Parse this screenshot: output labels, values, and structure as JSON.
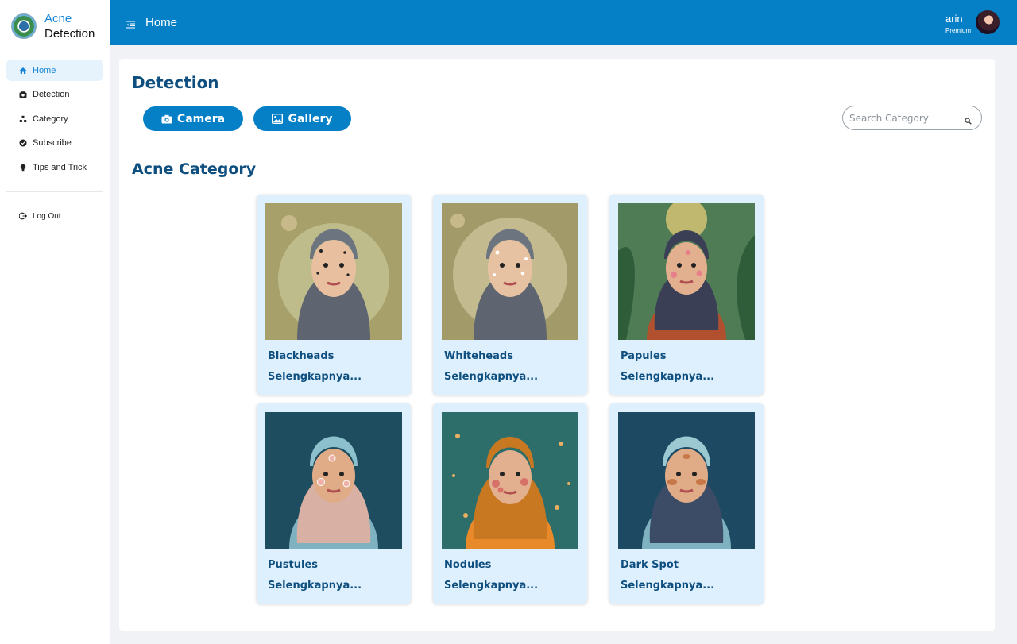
{
  "brand": {
    "line1": "Acne",
    "line2": "Detection"
  },
  "sidebar": {
    "items": [
      {
        "label": "Home",
        "icon": "home-icon",
        "active": true
      },
      {
        "label": "Detection",
        "icon": "camera-icon"
      },
      {
        "label": "Category",
        "icon": "category-icon"
      },
      {
        "label": "Subscribe",
        "icon": "subscribe-icon"
      },
      {
        "label": "Tips and Trick",
        "icon": "bulb-icon"
      }
    ],
    "logout": "Log Out"
  },
  "topbar": {
    "title": "Home",
    "user": {
      "name": "arin",
      "role": "Premium"
    }
  },
  "detection": {
    "heading": "Detection",
    "camera_label": "Camera",
    "gallery_label": "Gallery",
    "search_placeholder": "Search Category"
  },
  "category": {
    "heading": "Acne Category",
    "link_label": "Selengkapnya...",
    "cards": [
      {
        "title": "Blackheads"
      },
      {
        "title": "Whiteheads"
      },
      {
        "title": "Papules"
      },
      {
        "title": "Pustules"
      },
      {
        "title": "Nodules"
      },
      {
        "title": "Dark Spot"
      }
    ]
  },
  "colors": {
    "primary": "#0580c7",
    "heading": "#0e4f80",
    "card_bg": "#def0fd"
  }
}
